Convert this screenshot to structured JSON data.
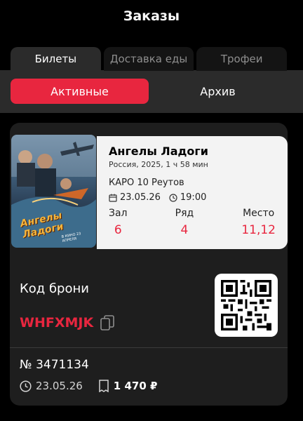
{
  "header": {
    "title": "Заказы"
  },
  "tabs": [
    {
      "label": "Билеты"
    },
    {
      "label": "Доставка еды"
    },
    {
      "label": "Трофеи"
    }
  ],
  "segments": [
    {
      "label": "Активные"
    },
    {
      "label": "Архив"
    }
  ],
  "ticket": {
    "poster": {
      "title": "Ангелы Ладоги",
      "release_note": "В КИНО 23 АПРЕЛЯ"
    },
    "film_title": "Ангелы Ладоги",
    "film_meta": "Россия, 2025, 1 ч 58 мин",
    "cinema": "КАРО 10 Реутов",
    "date": "23.05.26",
    "time": "19:00",
    "seats": [
      {
        "label": "Зал",
        "value": "6"
      },
      {
        "label": "Ряд",
        "value": "4"
      },
      {
        "label": "Место",
        "value": "11,12"
      }
    ],
    "booking_label": "Код брони",
    "booking_code": "WHFXMJK"
  },
  "order": {
    "number": "№ 3471134",
    "date": "23.05.26",
    "price": "1 470 ₽"
  },
  "colors": {
    "accent": "#e8263f",
    "card_bg": "#1e1e1e",
    "info_bg": "#f3f3f3"
  }
}
